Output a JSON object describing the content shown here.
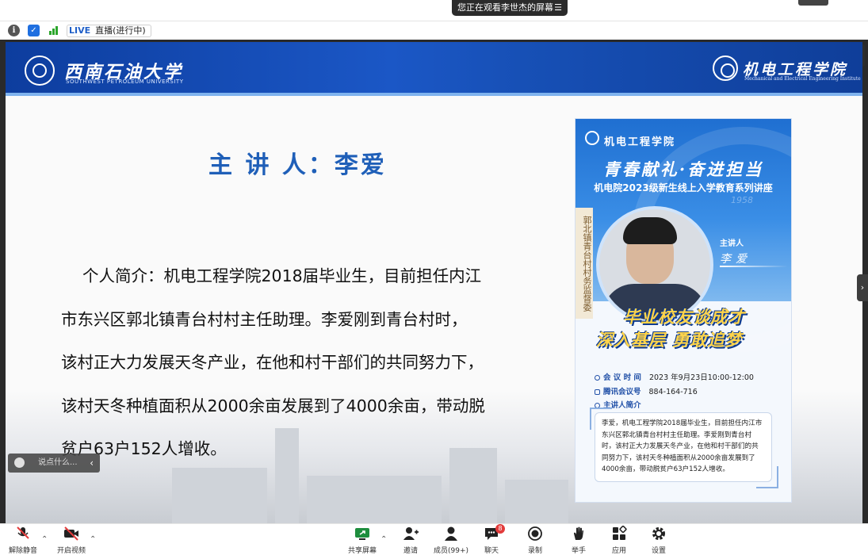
{
  "top": {
    "share_banner": "您正在观看李世杰的屏幕"
  },
  "meeting_bar": {
    "live_label": "LIVE",
    "live_status": "直播(进行中)"
  },
  "slide": {
    "university_cn": "西南石油大学",
    "university_en": "SOUTHWEST PETROLEUM UNIVERSITY",
    "college_cn": "机电工程学院",
    "college_en": "Mechanical and Electrical Engineering Institute",
    "speaker_title": "主 讲 人：李爱",
    "intro_lines": [
      "个人简介：机电工程学院2018届毕业生，目前担任内江",
      "市东兴区郭北镇青台村村主任助理。李爱刚到青台村时，",
      "该村正大力发展天冬产业，在他和村干部们的共同努力下，",
      "该村天冬种植面积从2000余亩发展到了4000余亩，带动脱",
      "贫户63户152人增收。"
    ]
  },
  "poster": {
    "college": "机电工程学院",
    "slogan": "青春献礼·奋进担当",
    "series": "机电院2023级新生线上入学教育系列讲座",
    "banner_text": "郭北镇青台村村务监督委",
    "speaker_label": "主讲人",
    "speaker_name": "李爱",
    "tag_line1": "毕业校友谈成才",
    "tag_line2": "深入基层 勇敢追梦",
    "time_key": "会 议 时 间",
    "time_value": "2023 年9月23日10:00-12:00",
    "meeting_key": "腾讯会议号",
    "meeting_value": "884-164-716",
    "intro_key": "主讲人简介",
    "intro_text": "李爱，机电工程学院2018届毕业生，目前担任内江市东兴区郭北镇青台村村主任助理。李爱刚到青台村时，该村正大力发展天冬产业，在他和村干部们的共同努力下，该村天冬种植面积从2000余亩发展到了4000余亩，带动脱贫户63户152人增收。",
    "year_mark": "1958"
  },
  "chat": {
    "placeholder": "说点什么..."
  },
  "toolbar": {
    "unmute": "解除静音",
    "video": "开启视频",
    "share": "共享屏幕",
    "invite": "邀请",
    "members": "成员(99+)",
    "chat": "聊天",
    "chat_badge": "8",
    "record": "录制",
    "raise_hand": "举手",
    "apps": "应用",
    "settings": "设置"
  },
  "colors": {
    "slide_blue": "#1b57c6",
    "title_blue": "#1f5fb8",
    "tag_yellow": "#ffd44a",
    "alert_red": "#e23b3b"
  }
}
